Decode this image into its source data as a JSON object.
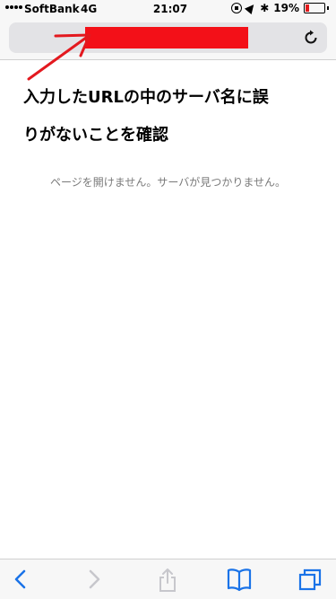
{
  "status_bar": {
    "carrier": "SoftBank",
    "network": "4G",
    "time": "21:07",
    "battery": "19%",
    "battery_level": 0.19
  },
  "address_bar": {
    "reload_icon": "reload-icon"
  },
  "annotation": {
    "line1": "入力したURLの中のサーバ名に誤",
    "line2": "りがないことを確認",
    "arrow_color": "#e3191f"
  },
  "page": {
    "error_message": "ページを開けません。サーバが見つかりません。"
  },
  "toolbar": {
    "icons": [
      "back-icon",
      "forward-icon",
      "share-icon",
      "bookmarks-icon",
      "tabs-icon"
    ]
  },
  "colors": {
    "accent": "#1a73e8",
    "redaction": "#f31018",
    "disabled": "#c7c7cc"
  }
}
